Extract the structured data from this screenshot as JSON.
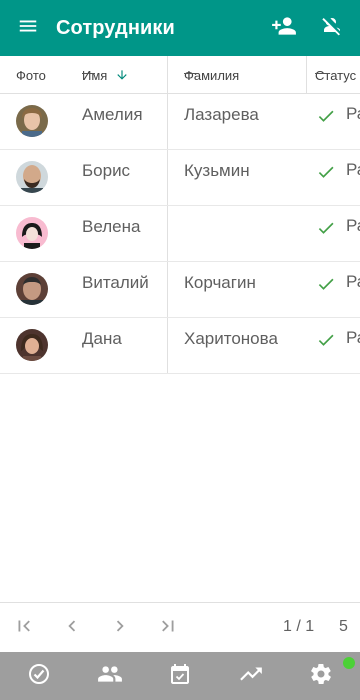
{
  "appbar": {
    "title": "Сотрудники",
    "menu_icon": "menu-icon",
    "add_icon": "person-add-icon",
    "remove_icon": "person-off-icon",
    "color": "#009688"
  },
  "table": {
    "columns": [
      {
        "label": "Фото"
      },
      {
        "label": "Имя",
        "sort": "ascending"
      },
      {
        "label": "Фамилия"
      },
      {
        "label": "Статус"
      }
    ],
    "rows": [
      {
        "first": "Амелия",
        "last": "Лазарева",
        "status": "Ра"
      },
      {
        "first": "Борис",
        "last": "Кузьмин",
        "status": "Ра"
      },
      {
        "first": "Велена",
        "last": "",
        "status": "Ра"
      },
      {
        "first": "Виталий",
        "last": "Корчагин",
        "status": "Ра"
      },
      {
        "first": "Дана",
        "last": "Харитонова",
        "status": "Ра"
      }
    ],
    "status_color": "#43a047"
  },
  "pager": {
    "info": "1 / 1",
    "page_size": "5",
    "icons": [
      "first-page-icon",
      "prev-page-icon",
      "next-page-icon",
      "last-page-icon"
    ]
  },
  "bottom_nav": {
    "items": [
      "tasks-icon",
      "people-icon",
      "calendar-icon",
      "trending-icon",
      "settings-icon"
    ],
    "color": "#9e9e9e",
    "online_color": "#4cd137"
  }
}
